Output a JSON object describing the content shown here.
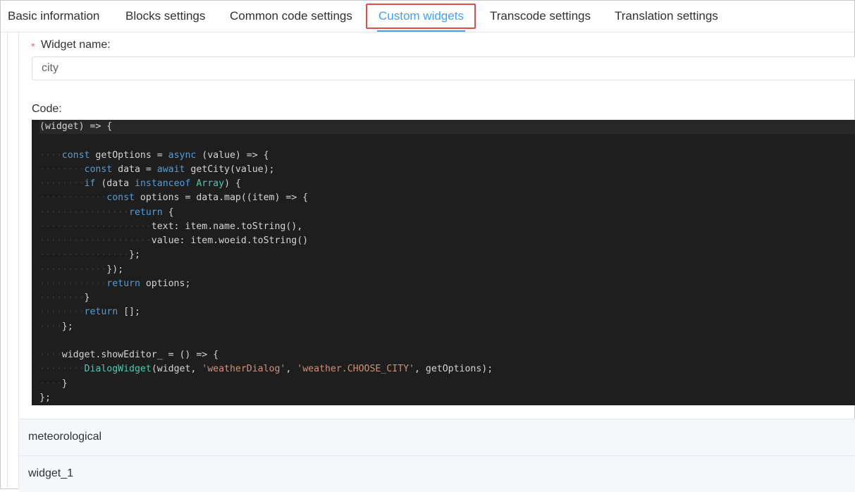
{
  "tabs": [
    {
      "label": "Basic information"
    },
    {
      "label": "Blocks settings"
    },
    {
      "label": "Common code settings"
    },
    {
      "label": "Custom widgets"
    },
    {
      "label": "Transcode settings"
    },
    {
      "label": "Translation settings"
    }
  ],
  "form": {
    "required_mark": "*",
    "widget_name_label": "Widget name:",
    "widget_name_value": "city",
    "code_label": "Code:"
  },
  "code_lines": [
    "(widget) => {",
    "",
    "    const getOptions = async (value) => {",
    "        const data = await getCity(value);",
    "        if (data instanceof Array) {",
    "            const options = data.map((item) => {",
    "                return {",
    "                    text: item.name.toString(),",
    "                    value: item.woeid.toString()",
    "                };",
    "            });",
    "            return options;",
    "        }",
    "        return [];",
    "    };",
    "",
    "    widget.showEditor_ = () => {",
    "        DialogWidget(widget, 'weatherDialog', 'weather.CHOOSE_CITY', getOptions);",
    "    }",
    "};"
  ],
  "widget_list": [
    {
      "name": "meteorological"
    },
    {
      "name": "widget_1"
    }
  ],
  "colors": {
    "accent": "#409eff",
    "highlight_border": "#e14b4b",
    "editor_bg": "#1e1e1e",
    "keyword": "#569cd6",
    "string": "#ce9178",
    "class": "#4ec9b0"
  }
}
